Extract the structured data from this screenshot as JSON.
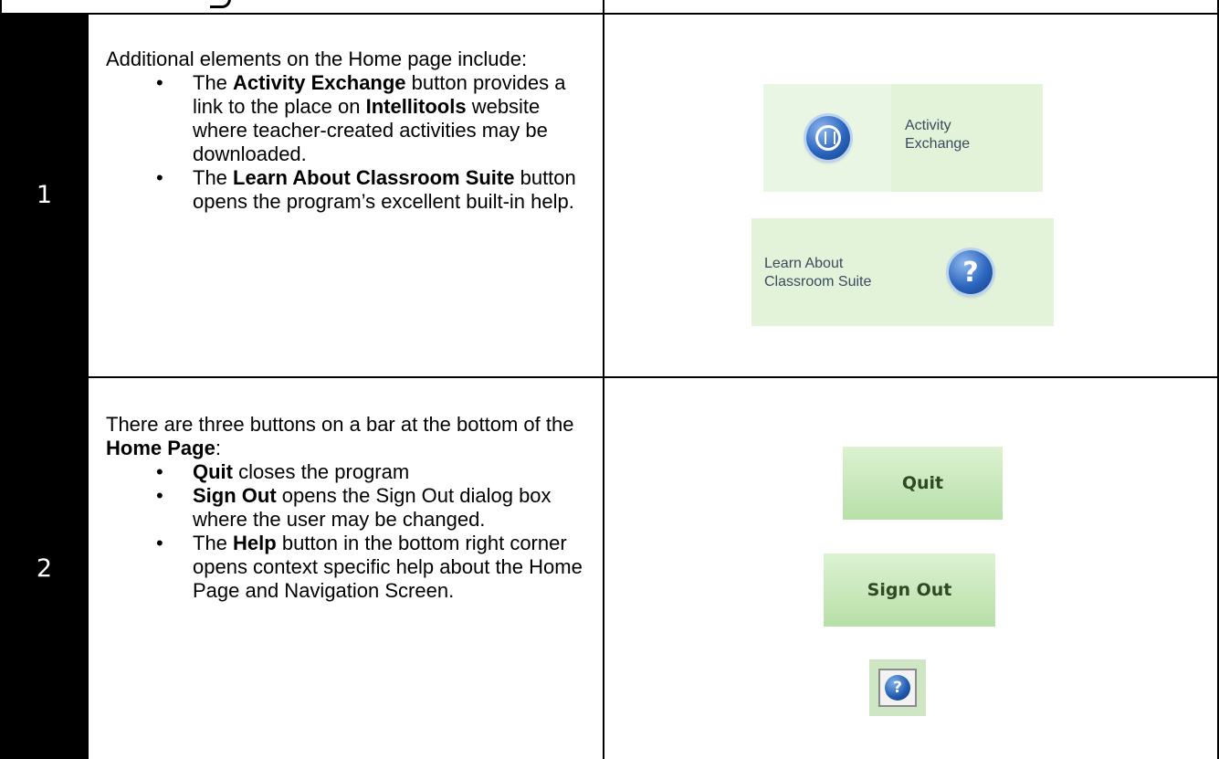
{
  "rows": [
    {
      "number": "1",
      "intro": "Additional elements on the Home page include:",
      "bullets": [
        {
          "pre": "The ",
          "bold": "Activity Exchange",
          "post": " button provides a link to the place on ",
          "bold2": "Intellitools",
          "post2": " website where teacher-created activities may be downloaded."
        },
        {
          "pre": "The ",
          "bold": "Learn About Classroom Suite",
          "post": " button opens the program’s excellent built-in help."
        }
      ],
      "images": {
        "activity_exchange_label": "Activity Exchange",
        "learn_about_label": "Learn About Classroom Suite"
      }
    },
    {
      "number": "2",
      "intro_pre": "There are three buttons on a bar at the bottom of the ",
      "intro_bold": "Home Page",
      "intro_post": ":",
      "bullets": [
        {
          "bold": "Quit",
          "post": " closes the program"
        },
        {
          "bold": "Sign Out",
          "post": " opens the Sign Out dialog box where the user may be changed."
        },
        {
          "pre": "The ",
          "bold": "Help",
          "post": " button in the bottom right corner opens context specific help about the Home Page and Navigation Screen."
        }
      ],
      "images": {
        "quit_label": "Quit",
        "signout_label": "Sign Out",
        "help_glyph": "?"
      }
    }
  ],
  "colors": {
    "number_column_bg": "#000000",
    "panel_green": "#e2f3da",
    "icon_blue": "#2c66bf"
  },
  "icons": {
    "activity_exchange": "exchange-icon",
    "learn_about": "help-icon",
    "help_button": "help-icon"
  }
}
